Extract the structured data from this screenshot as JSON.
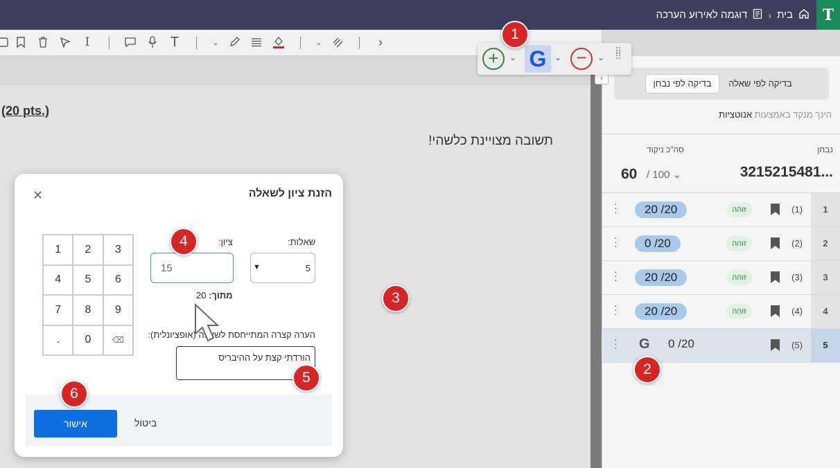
{
  "header": {
    "home_label": "בית",
    "page_label": "דוגמה לאירוע הערכה",
    "logo_glyph": "T"
  },
  "document": {
    "points_heading": "(20 pts.)",
    "answer_text": "תשובה מצויינת כלשהי!"
  },
  "side_panel": {
    "toggle_by_question": "בדיקה לפי שאלה",
    "toggle_by_student": "בדיקה לפי נבחן",
    "hint_prefix": "הינך מנקד באמצעות",
    "hint_value": "אנוטציות",
    "student_label": "נבחן",
    "total_label": "סה\"כ ניקוד",
    "student_id": "3215215481...",
    "total_score": "60",
    "total_max": "/ 100",
    "questions": [
      {
        "num": "1",
        "label": "(1)",
        "tag": "זוהה",
        "score": "20  /20"
      },
      {
        "num": "2",
        "label": "(2)",
        "tag": "זוהה",
        "score": "0  /20"
      },
      {
        "num": "3",
        "label": "(3)",
        "tag": "זוהה",
        "score": "20  /20"
      },
      {
        "num": "4",
        "label": "(4)",
        "tag": "זוהה",
        "score": "20  /20"
      },
      {
        "num": "5",
        "label": "(5)",
        "score": "0  /20"
      }
    ]
  },
  "grade_toolbar": {
    "g_label": "G"
  },
  "modal": {
    "title": "הזנת ציון לשאלה",
    "questions_label": "שאלות:",
    "question_value": "5",
    "grade_label": "ציון:",
    "grade_value": "15",
    "out_of_label": "מתוך:",
    "out_of_value": "20",
    "comment_label": "הערה קצרה המתייחסת לשאלה (אופציונלית):",
    "comment_value": "הורדתי קצת על ההיבריס",
    "keypad": [
      "3",
      "2",
      "1",
      "6",
      "5",
      "4",
      "9",
      "8",
      "7",
      "⌫",
      "0",
      "."
    ],
    "confirm_label": "אישור",
    "cancel_label": "ביטול"
  },
  "callouts": [
    "1",
    "2",
    "3",
    "4",
    "5",
    "6"
  ],
  "colors": {
    "topbar": "#3d3f5c",
    "accent_blue": "#0d6fe0",
    "score_pill": "#a9c9ea",
    "callout_red": "#d62525",
    "plus_green": "#2e8b3e",
    "minus_red": "#c0392b"
  }
}
